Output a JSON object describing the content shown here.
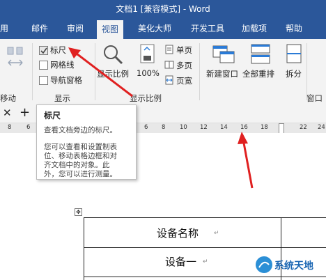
{
  "window": {
    "title": "文档1 [兼容模式] - Word"
  },
  "tabs": [
    "用",
    "邮件",
    "审阅",
    "视图",
    "美化大师",
    "开发工具",
    "加载项",
    "帮助"
  ],
  "ribbon": {
    "move_label": "移动",
    "show_group": {
      "label": "显示",
      "ruler": "标尺",
      "gridlines": "网格线",
      "nav_pane": "导航窗格"
    },
    "zoom_group": {
      "label": "显示比例",
      "zoom": "显示比例",
      "hundred": "100%",
      "single": "单页",
      "multi": "多页",
      "width": "页宽"
    },
    "window_group": {
      "new_window": "新建窗口",
      "arrange_all": "全部重排",
      "split": "拆分",
      "label": "窗口"
    },
    "ruler_checked": true
  },
  "tooltip": {
    "title": "标尺",
    "summary": "查看文档旁边的标尺。",
    "detail": [
      "您可以查看和设置制表",
      "位、移动表格边框和对",
      "齐文档中的对象。此",
      "外，您可以进行测量。"
    ]
  },
  "ruler_numbers": [
    "8",
    "6",
    "6",
    "8",
    "10",
    "12",
    "14",
    "16",
    "18",
    "22",
    "24"
  ],
  "table": {
    "header": "设备名称",
    "row1": "设备一"
  },
  "watermark": "系统天地",
  "accent": "#2b579a",
  "arrow_color": "#e02020"
}
